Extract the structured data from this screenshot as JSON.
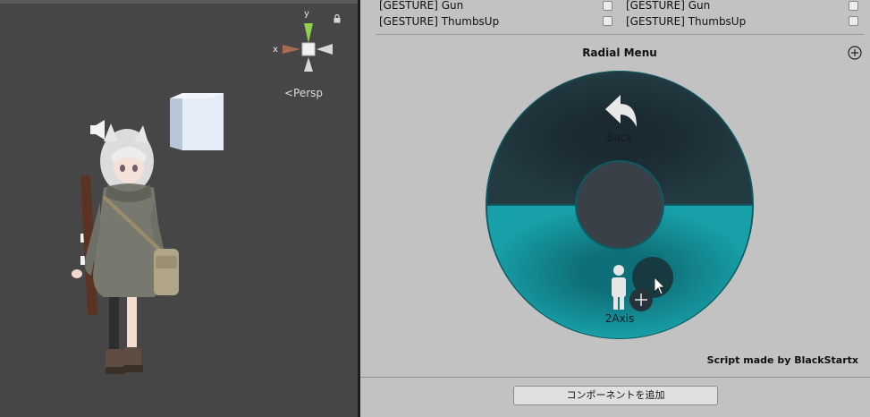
{
  "scene": {
    "gizmo": {
      "y_label": "y",
      "x_label": "x"
    },
    "persp_label": "<Persp",
    "icons": [
      "lock-icon",
      "speaker-icon",
      "cube-object",
      "avatar-character"
    ]
  },
  "inspector": {
    "gesture_columns": [
      {
        "rows": [
          {
            "label": "[GESTURE] Gun"
          },
          {
            "label": "[GESTURE] ThumbsUp"
          }
        ]
      },
      {
        "rows": [
          {
            "label": "[GESTURE] Gun"
          },
          {
            "label": "[GESTURE] ThumbsUp"
          }
        ]
      }
    ],
    "radial_menu": {
      "title": "Radial Menu",
      "add_icon": "plus-circle-icon",
      "back_label": "Back",
      "axis_label": "2Axis",
      "colors": {
        "top_half": "#1f3238",
        "bottom_half": "#16959c",
        "ring": "#0e5a62",
        "center": "#3a4048"
      }
    },
    "credit": "Script made by BlackStartx",
    "add_component_label": "コンポーネントを追加"
  }
}
